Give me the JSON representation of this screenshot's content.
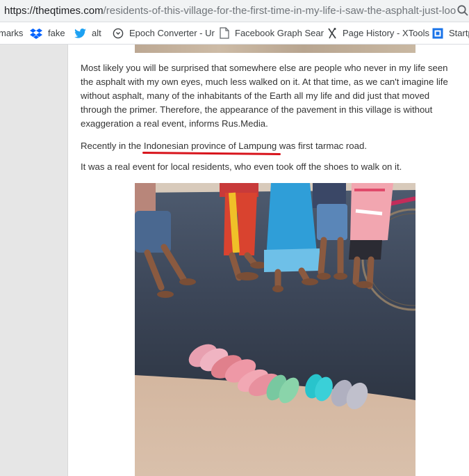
{
  "browser": {
    "url_domain": "https://theqtimes.com",
    "url_path": "/residents-of-this-village-for-the-first-time-in-my-life-i-saw-the-asphalt-just-loo..."
  },
  "bookmarks": [
    {
      "label": "marks",
      "icon": "none"
    },
    {
      "label": "fake",
      "icon": "dropbox-icon"
    },
    {
      "label": "alt",
      "icon": "twitter-icon"
    },
    {
      "label": "Epoch Converter - Ur",
      "icon": "clock-icon"
    },
    {
      "label": "Facebook Graph Sear",
      "icon": "page-icon"
    },
    {
      "label": "Page History - XTools",
      "icon": "xtools-icon"
    },
    {
      "label": "Startp",
      "icon": "startpage-icon"
    }
  ],
  "article": {
    "paragraph1": "Most likely you will be surprised that somewhere else are people who never in my life seen the asphalt with my own eyes, much less walked on it. At that time, as we can't imagine life without asphalt, many of the inhabitants of the Earth all my life and did just that moved through the primer. Therefore, the appearance of the pavement in this village is without exaggeration a real event, informs Rus.Media.",
    "paragraph2_before": "Recently in the ",
    "paragraph2_link": "Indonesian province of Lampung",
    "paragraph2_after": " was first tarmac road.",
    "paragraph3": "It was a real event for local residents, who even took off the shoes to walk on it."
  },
  "colors": {
    "annotation_red": "#d8141c",
    "twitter_blue": "#1da1f2",
    "dropbox_blue": "#0061fe"
  }
}
